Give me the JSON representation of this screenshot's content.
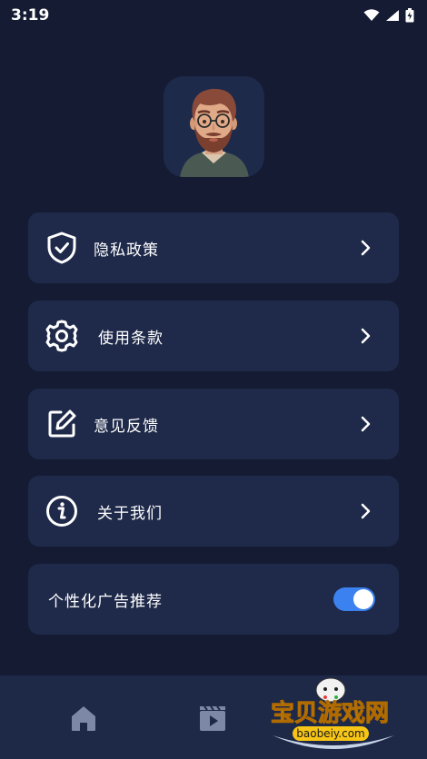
{
  "status": {
    "time": "3:19",
    "icons": [
      "wifi-icon",
      "signal-icon",
      "battery-charging-icon"
    ]
  },
  "profile": {
    "avatar": "avatar-3d-bearded-man"
  },
  "menu": {
    "items": [
      {
        "label": "隐私政策",
        "icon": "shield-check-icon"
      },
      {
        "label": "使用条款",
        "icon": "gear-icon"
      },
      {
        "label": "意见反馈",
        "icon": "edit-icon"
      },
      {
        "label": "关于我们",
        "icon": "info-icon"
      }
    ],
    "toggle": {
      "label": "个性化广告推荐",
      "on": true
    }
  },
  "nav": {
    "items": [
      "home-icon",
      "video-icon"
    ]
  },
  "watermark": {
    "title": "宝贝游戏网",
    "url": "baobeiy.com"
  },
  "colors": {
    "background": "#141b33",
    "card": "#1f2a4a",
    "accent": "#3b82f0"
  }
}
